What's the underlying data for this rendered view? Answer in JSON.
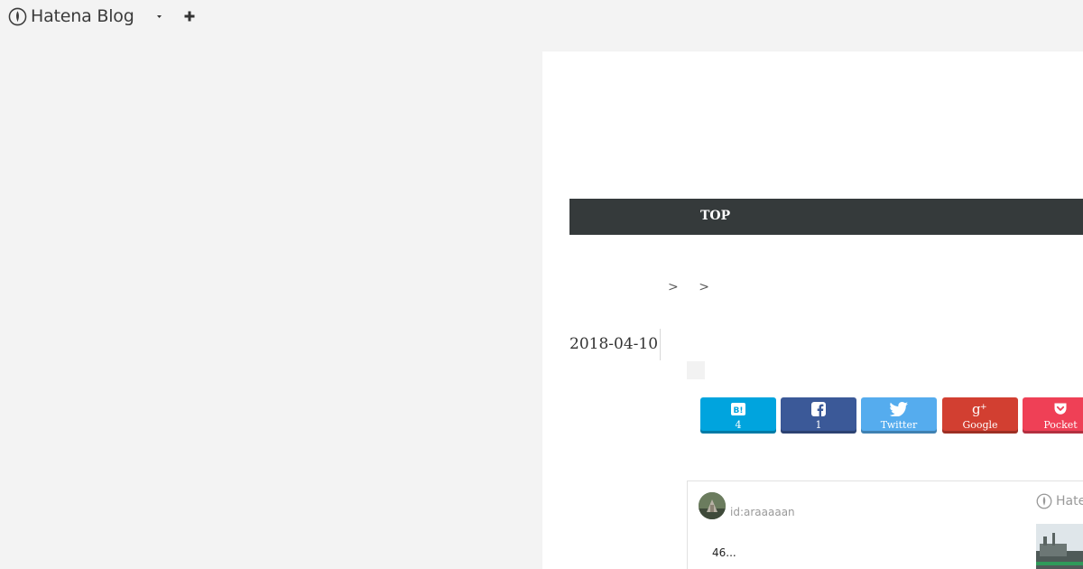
{
  "app": {
    "brand": "Hatena Blog"
  },
  "nav": {
    "top_label": "TOP"
  },
  "breadcrumb": {
    "separators": [
      ">",
      ">"
    ]
  },
  "article": {
    "date": "2018-04-10"
  },
  "share": {
    "hatena": {
      "icon": "hatena-bookmark-icon",
      "label": "4",
      "color": "#00a4de"
    },
    "facebook": {
      "icon": "facebook-icon",
      "label": "1",
      "color": "#3b5998"
    },
    "twitter": {
      "icon": "twitter-icon",
      "label": "Twitter",
      "color": "#55acee"
    },
    "google": {
      "icon": "google-plus-icon",
      "label": "Google",
      "color": "#d23f31"
    },
    "pocket": {
      "icon": "pocket-icon",
      "label": "Pocket",
      "color": "#ef4056"
    }
  },
  "card": {
    "user_id": "id:araaaaan",
    "text": "46...",
    "brand": "Hate"
  },
  "colors": {
    "background": "#f3f3f3",
    "navbar": "#353a3b"
  }
}
